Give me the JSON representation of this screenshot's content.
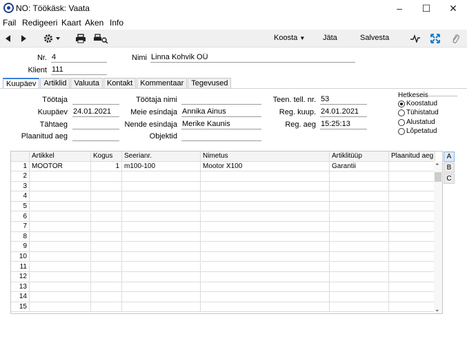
{
  "window": {
    "title": "NO: Töökäsk: Vaata",
    "min": "–",
    "max": "☐",
    "close": "✕"
  },
  "menu": [
    "Fail",
    "Redigeeri",
    "Kaart",
    "Aken",
    "Info"
  ],
  "toolbar": {
    "koosta": "Koosta",
    "jata": "Jäta",
    "salvesta": "Salvesta"
  },
  "header": {
    "nr_label": "Nr.",
    "nr_value": "4",
    "nimi_label": "Nimi",
    "nimi_value": "Linna Kohvik OÜ",
    "klient_label": "Klient",
    "klient_value": "111"
  },
  "tabs": [
    "Kuupäev",
    "Artiklid",
    "Valuuta",
    "Kontakt",
    "Kommentaar",
    "Tegevused"
  ],
  "form": {
    "tootaja_label": "Töötaja",
    "tootaja_value": "",
    "tootaja_nimi_label": "Töötaja nimi",
    "tootaja_nimi_value": "",
    "teen_label": "Teen. tell. nr.",
    "teen_value": "53",
    "kuupaev_label": "Kuupäev",
    "kuupaev_value": "24.01.2021",
    "meie_label": "Meie esindaja",
    "meie_value": "Annika Ainus",
    "regkuup_label": "Reg. kuup.",
    "regkuup_value": "24.01.2021",
    "tahtaeg_label": "Tähtaeg",
    "tahtaeg_value": "",
    "nende_label": "Nende esindaja",
    "nende_value": "Merike Kaunis",
    "regaeg_label": "Reg. aeg",
    "regaeg_value": "15:25:13",
    "plaanitud_label": "Plaanitud aeg",
    "plaanitud_value": "",
    "objektid_label": "Objektid",
    "objektid_value": ""
  },
  "status": {
    "title": "Hetkeseis",
    "options": [
      "Koostatud",
      "Tühistatud",
      "Alustatud",
      "Lõpetatud"
    ],
    "selected": 0
  },
  "grid": {
    "headers": [
      "",
      "Artikkel",
      "Kogus",
      "Seerianr.",
      "Nimetus",
      "Artiklitüüp",
      "Plaanitud aeg"
    ],
    "rows": [
      [
        "1",
        "MOOTOR",
        "1",
        "m100-100",
        "Mootor X100",
        "Garantii",
        ""
      ],
      [
        "2",
        "",
        "",
        "",
        "",
        "",
        ""
      ],
      [
        "3",
        "",
        "",
        "",
        "",
        "",
        ""
      ],
      [
        "4",
        "",
        "",
        "",
        "",
        "",
        ""
      ],
      [
        "5",
        "",
        "",
        "",
        "",
        "",
        ""
      ],
      [
        "6",
        "",
        "",
        "",
        "",
        "",
        ""
      ],
      [
        "7",
        "",
        "",
        "",
        "",
        "",
        ""
      ],
      [
        "8",
        "",
        "",
        "",
        "",
        "",
        ""
      ],
      [
        "9",
        "",
        "",
        "",
        "",
        "",
        ""
      ],
      [
        "10",
        "",
        "",
        "",
        "",
        "",
        ""
      ],
      [
        "11",
        "",
        "",
        "",
        "",
        "",
        ""
      ],
      [
        "12",
        "",
        "",
        "",
        "",
        "",
        ""
      ],
      [
        "13",
        "",
        "",
        "",
        "",
        "",
        ""
      ],
      [
        "14",
        "",
        "",
        "",
        "",
        "",
        ""
      ],
      [
        "15",
        "",
        "",
        "",
        "",
        "",
        ""
      ]
    ],
    "side_tabs": [
      "A",
      "B",
      "C"
    ]
  }
}
